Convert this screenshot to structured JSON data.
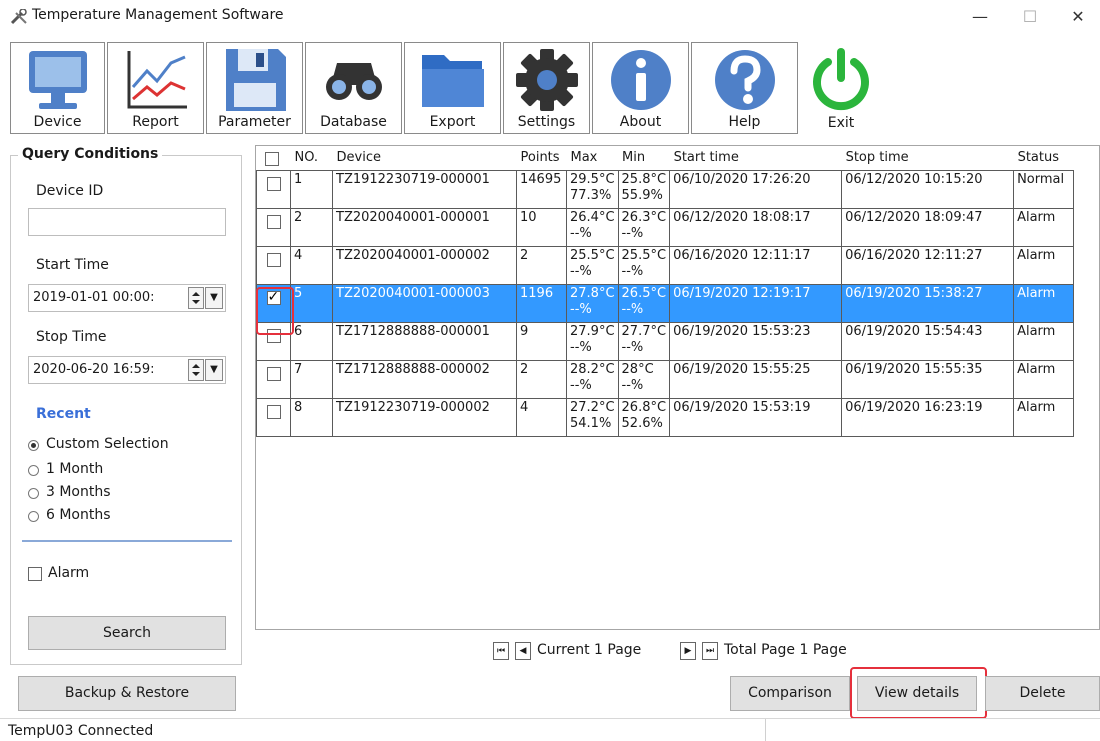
{
  "window": {
    "title": "Temperature Management Software",
    "minimize": "—",
    "maximize": "☐",
    "close": "✕"
  },
  "toolbar": [
    {
      "label": "Device"
    },
    {
      "label": "Report"
    },
    {
      "label": "Parameter"
    },
    {
      "label": "Database"
    },
    {
      "label": "Export"
    },
    {
      "label": "Settings"
    },
    {
      "label": "About"
    },
    {
      "label": "Help"
    },
    {
      "label": "Exit"
    }
  ],
  "query": {
    "legend": "Query Conditions",
    "device_id_label": "Device ID",
    "device_id_value": "",
    "start_label": "Start Time",
    "start_value": "2019-01-01 00:00:",
    "stop_label": "Stop Time",
    "stop_value": "2020-06-20 16:59:",
    "recent_label": "Recent",
    "options": [
      "Custom Selection",
      "1 Month",
      "3 Months",
      "6 Months"
    ],
    "selected_option": "Custom Selection",
    "alarm_label": "Alarm",
    "search_label": "Search",
    "accent_color": "#3a6fd8"
  },
  "table": {
    "headers": [
      "NO.",
      "Device",
      "Points",
      "Max",
      "Min",
      "Start time",
      "Stop time",
      "Status"
    ],
    "rows": [
      {
        "no": "1",
        "device": "TZ1912230719-000001",
        "points": "14695",
        "max1": "29.5°C",
        "max2": "77.3%",
        "min1": "25.8°C",
        "min2": "55.9%",
        "start": "06/10/2020 17:26:20",
        "stop": "06/12/2020 10:15:20",
        "status": "Normal",
        "checked": false,
        "selected": false
      },
      {
        "no": "2",
        "device": "TZ2020040001-000001",
        "points": "10",
        "max1": "26.4°C",
        "max2": "--%",
        "min1": "26.3°C",
        "min2": "--%",
        "start": "06/12/2020 18:08:17",
        "stop": "06/12/2020 18:09:47",
        "status": "Alarm",
        "checked": false,
        "selected": false
      },
      {
        "no": "4",
        "device": "TZ2020040001-000002",
        "points": "2",
        "max1": "25.5°C",
        "max2": "--%",
        "min1": "25.5°C",
        "min2": "--%",
        "start": "06/16/2020 12:11:17",
        "stop": "06/16/2020 12:11:27",
        "status": "Alarm",
        "checked": false,
        "selected": false
      },
      {
        "no": "5",
        "device": "TZ2020040001-000003",
        "points": "1196",
        "max1": "27.8°C",
        "max2": "--%",
        "min1": "26.5°C",
        "min2": "--%",
        "start": "06/19/2020 12:19:17",
        "stop": "06/19/2020 15:38:27",
        "status": "Alarm",
        "checked": true,
        "selected": true
      },
      {
        "no": "6",
        "device": "TZ1712888888-000001",
        "points": "9",
        "max1": "27.9°C",
        "max2": "--%",
        "min1": "27.7°C",
        "min2": "--%",
        "start": "06/19/2020 15:53:23",
        "stop": "06/19/2020 15:54:43",
        "status": "Alarm",
        "checked": false,
        "selected": false
      },
      {
        "no": "7",
        "device": "TZ1712888888-000002",
        "points": "2",
        "max1": "28.2°C",
        "max2": "--%",
        "min1": "28°C",
        "min2": "--%",
        "start": "06/19/2020 15:55:25",
        "stop": "06/19/2020 15:55:35",
        "status": "Alarm",
        "checked": false,
        "selected": false
      },
      {
        "no": "8",
        "device": "TZ1912230719-000002",
        "points": "4",
        "max1": "27.2°C",
        "max2": "54.1%",
        "min1": "26.8°C",
        "min2": "52.6%",
        "start": "06/19/2020 15:53:19",
        "stop": "06/19/2020 16:23:19",
        "status": "Alarm",
        "checked": false,
        "selected": false
      }
    ],
    "selected_color": "#3399ff",
    "highlight_color": "#e5303c"
  },
  "pager": {
    "current": "Current 1 Page",
    "total": "Total Page 1 Page"
  },
  "bottom": {
    "backup": "Backup & Restore",
    "comparison": "Comparison",
    "view_details": "View details",
    "delete": "Delete"
  },
  "statusbar": {
    "text": "TempU03 Connected"
  }
}
